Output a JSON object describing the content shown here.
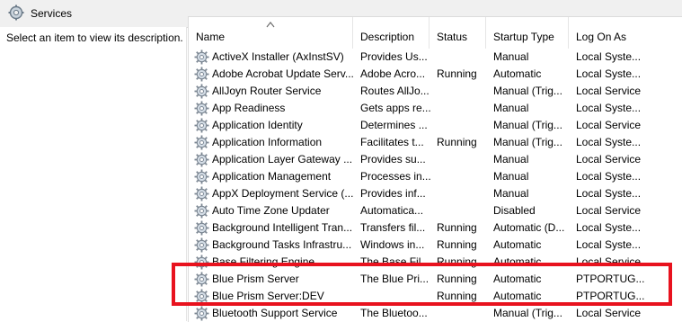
{
  "window": {
    "title": "Services",
    "icon": "services-gear-icon"
  },
  "left_pane": {
    "description": "Select an item to view its description."
  },
  "columns": [
    "Name",
    "Description",
    "Status",
    "Startup Type",
    "Log On As"
  ],
  "sorted_column": "Name",
  "services": [
    {
      "name": "ActiveX Installer (AxInstSV)",
      "description": "Provides Us...",
      "status": "",
      "startup": "Manual",
      "logon": "Local Syste..."
    },
    {
      "name": "Adobe Acrobat Update Serv...",
      "description": "Adobe Acro...",
      "status": "Running",
      "startup": "Automatic",
      "logon": "Local Syste..."
    },
    {
      "name": "AllJoyn Router Service",
      "description": "Routes AllJo...",
      "status": "",
      "startup": "Manual (Trig...",
      "logon": "Local Service"
    },
    {
      "name": "App Readiness",
      "description": "Gets apps re...",
      "status": "",
      "startup": "Manual",
      "logon": "Local Syste..."
    },
    {
      "name": "Application Identity",
      "description": "Determines ...",
      "status": "",
      "startup": "Manual (Trig...",
      "logon": "Local Service"
    },
    {
      "name": "Application Information",
      "description": "Facilitates t...",
      "status": "Running",
      "startup": "Manual (Trig...",
      "logon": "Local Syste..."
    },
    {
      "name": "Application Layer Gateway ...",
      "description": "Provides su...",
      "status": "",
      "startup": "Manual",
      "logon": "Local Service"
    },
    {
      "name": "Application Management",
      "description": "Processes in...",
      "status": "",
      "startup": "Manual",
      "logon": "Local Syste..."
    },
    {
      "name": "AppX Deployment Service (...",
      "description": "Provides inf...",
      "status": "",
      "startup": "Manual",
      "logon": "Local Syste..."
    },
    {
      "name": "Auto Time Zone Updater",
      "description": "Automatica...",
      "status": "",
      "startup": "Disabled",
      "logon": "Local Service"
    },
    {
      "name": "Background Intelligent Tran...",
      "description": "Transfers fil...",
      "status": "Running",
      "startup": "Automatic (D...",
      "logon": "Local Syste..."
    },
    {
      "name": "Background Tasks Infrastru...",
      "description": "Windows in...",
      "status": "Running",
      "startup": "Automatic",
      "logon": "Local Syste..."
    },
    {
      "name": "Base Filtering Engine",
      "description": "The Base Fil...",
      "status": "Running",
      "startup": "Automatic",
      "logon": "Local Service"
    },
    {
      "name": "Blue Prism Server",
      "description": "The Blue Pri...",
      "status": "Running",
      "startup": "Automatic",
      "logon": "PTPORTUG..."
    },
    {
      "name": "Blue Prism Server:DEV",
      "description": "",
      "status": "Running",
      "startup": "Automatic",
      "logon": "PTPORTUG..."
    },
    {
      "name": "Bluetooth Support Service",
      "description": "The Bluetoo...",
      "status": "",
      "startup": "Manual (Trig...",
      "logon": "Local Service"
    }
  ],
  "highlight": {
    "color": "#e8121e"
  }
}
